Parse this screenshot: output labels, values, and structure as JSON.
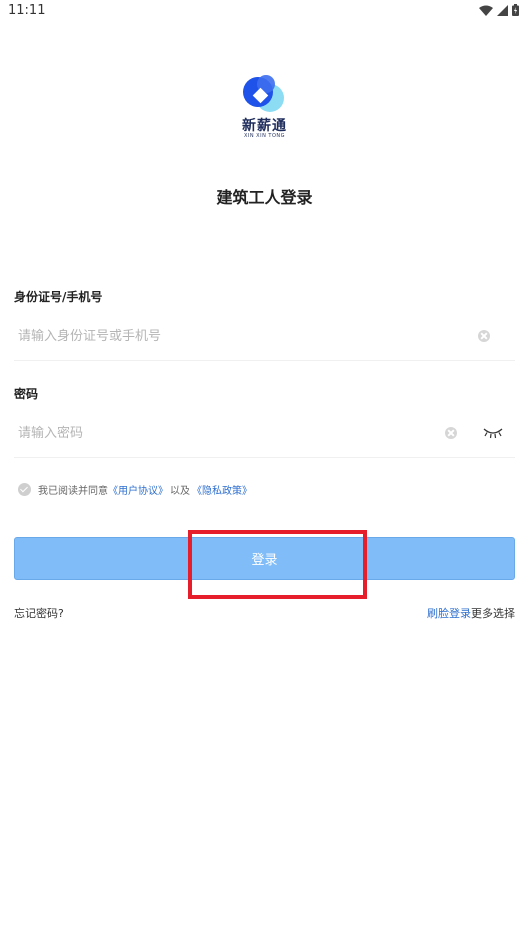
{
  "status_bar": {
    "time": "11:11"
  },
  "brand": {
    "name": "新薪通",
    "sub": "XIN XIN TONG",
    "colors": {
      "primary": "#1e52e8",
      "light": "#7fd8f2"
    }
  },
  "title": "建筑工人登录",
  "fields": {
    "account": {
      "label": "身份证号/手机号",
      "placeholder": "请输入身份证号或手机号",
      "value": ""
    },
    "password": {
      "label": "密码",
      "placeholder": "请输入密码",
      "value": ""
    }
  },
  "agreement": {
    "prefix": "我已阅读并同意",
    "user_agreement": "《用户协议》",
    "and": "以及",
    "privacy_policy": "《隐私政策》"
  },
  "login_button": {
    "label": "登录",
    "color": "#80bdf8"
  },
  "footer": {
    "forgot": "忘记密码?",
    "face_login": "刷脸登录",
    "more": "更多选择"
  },
  "highlight_color": "#e61e2b"
}
